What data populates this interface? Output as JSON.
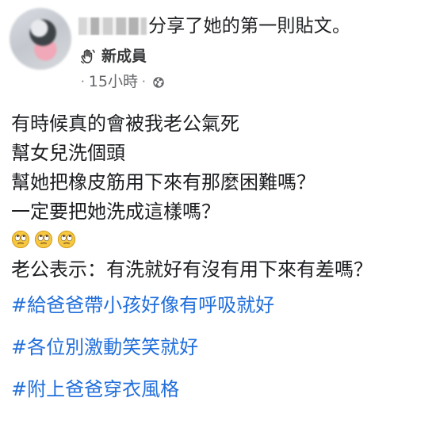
{
  "post": {
    "share_text": "分享了她的第一則貼文。",
    "badge": {
      "icon": "waving-hand-icon",
      "label": "新成員"
    },
    "meta": {
      "separator_1": "·",
      "time": "15小時",
      "separator_2": "·",
      "privacy_icon": "globe-icon"
    },
    "body_lines": [
      "有時候真的會被我老公氣死",
      "幫女兒洗個頭",
      "幫她把橡皮筋用下來有那麼困難嗎？",
      "一定要把她洗成這樣嗎？"
    ],
    "emoji_row": [
      "face-with-rolling-eyes-icon",
      "face-with-rolling-eyes-icon",
      "face-with-rolling-eyes-icon"
    ],
    "after_emoji_line": "老公表示：有洗就好有沒有用下來有差嗎？",
    "hashtags": [
      "#給爸爸帶小孩好像有呼吸就好",
      "#各位別激動笑笑就好",
      "#附上爸爸穿衣風格"
    ],
    "colors": {
      "text": "#1c1e21",
      "meta": "#65676b",
      "hashtag": "#216fdb",
      "background": "#ffffff"
    }
  }
}
